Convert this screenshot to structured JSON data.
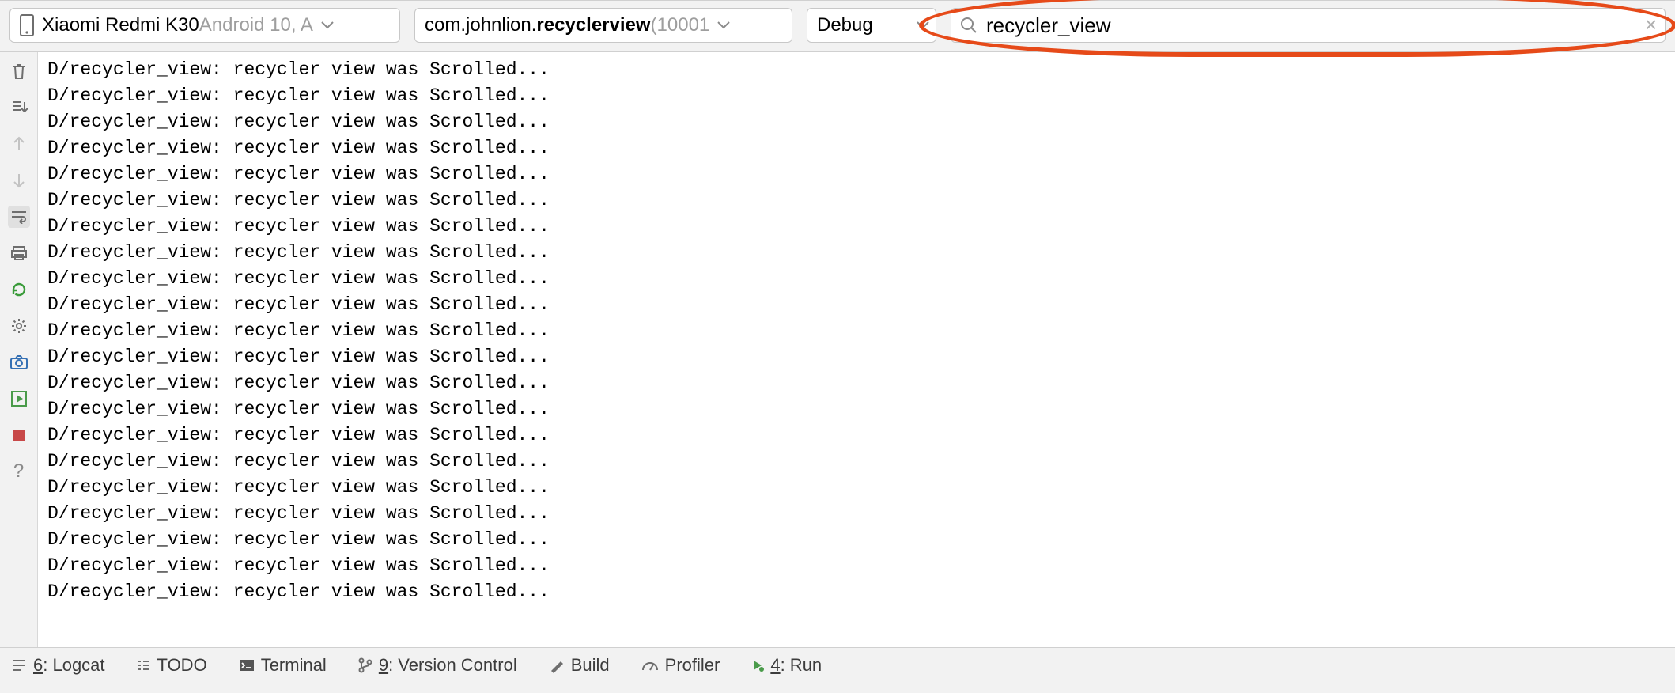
{
  "filters": {
    "device": {
      "prefix": "Xiaomi Redmi K30 ",
      "suffix": "Android 10, A"
    },
    "process": {
      "prefix": "com.johnlion.",
      "bold": "recyclerview",
      "suffix": " (10001"
    },
    "level": "Debug",
    "search": "recycler_view"
  },
  "log_lines": [
    "D/recycler_view: recycler view was Scrolled...",
    "D/recycler_view: recycler view was Scrolled...",
    "D/recycler_view: recycler view was Scrolled...",
    "D/recycler_view: recycler view was Scrolled...",
    "D/recycler_view: recycler view was Scrolled...",
    "D/recycler_view: recycler view was Scrolled...",
    "D/recycler_view: recycler view was Scrolled...",
    "D/recycler_view: recycler view was Scrolled...",
    "D/recycler_view: recycler view was Scrolled...",
    "D/recycler_view: recycler view was Scrolled...",
    "D/recycler_view: recycler view was Scrolled...",
    "D/recycler_view: recycler view was Scrolled...",
    "D/recycler_view: recycler view was Scrolled...",
    "D/recycler_view: recycler view was Scrolled...",
    "D/recycler_view: recycler view was Scrolled...",
    "D/recycler_view: recycler view was Scrolled...",
    "D/recycler_view: recycler view was Scrolled...",
    "D/recycler_view: recycler view was Scrolled...",
    "D/recycler_view: recycler view was Scrolled...",
    "D/recycler_view: recycler view was Scrolled...",
    "D/recycler_view: recycler view was Scrolled..."
  ],
  "bottom_tabs": {
    "logcat": {
      "mnemonic": "6",
      "label": ": Logcat"
    },
    "todo": "TODO",
    "terminal": "Terminal",
    "vcs": {
      "mnemonic": "9",
      "label": ": Version Control"
    },
    "build": "Build",
    "profiler": "Profiler",
    "run": {
      "mnemonic": "4",
      "label": ": Run"
    }
  }
}
